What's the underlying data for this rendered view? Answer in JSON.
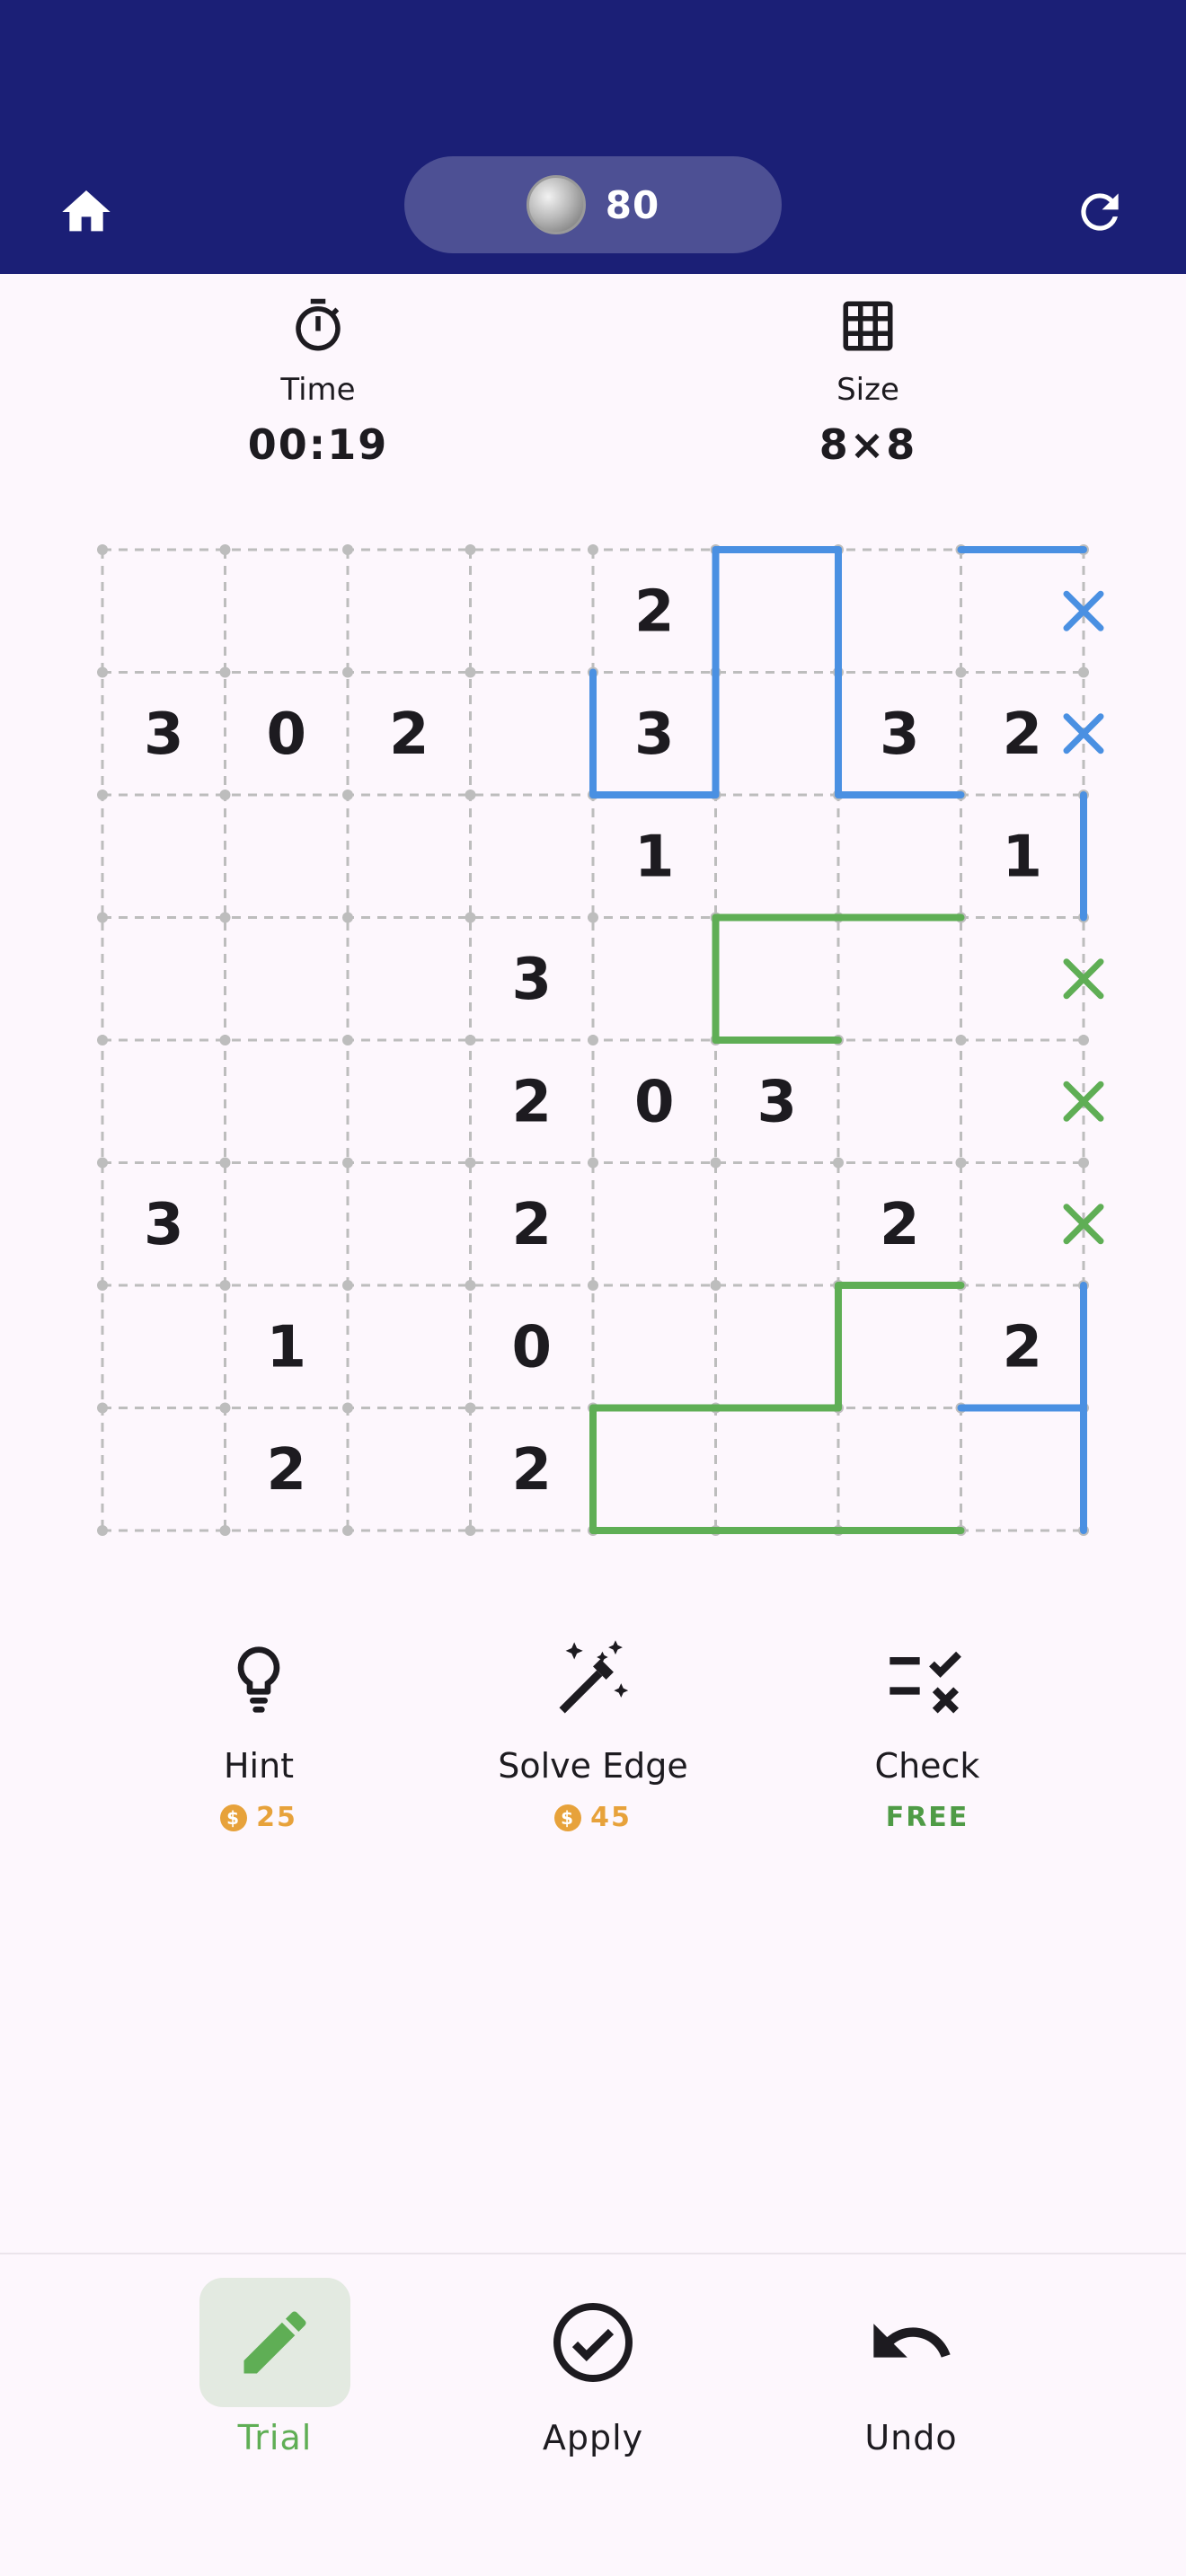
{
  "topbar": {
    "coins": "80",
    "home_icon": "home-icon",
    "refresh_icon": "refresh-icon"
  },
  "stats": {
    "time_label": "Time",
    "time_value": "00:19",
    "size_label": "Size",
    "size_value": "8×8"
  },
  "board": {
    "rows": 8,
    "cols": 8,
    "clues": [
      [
        "",
        "",
        "",
        "",
        "2",
        "",
        "",
        ""
      ],
      [
        "3",
        "0",
        "2",
        "",
        "3",
        "",
        "3",
        "2"
      ],
      [
        "",
        "",
        "",
        "",
        "1",
        "",
        "",
        "1"
      ],
      [
        "",
        "",
        "",
        "3",
        "",
        "",
        "",
        ""
      ],
      [
        "",
        "",
        "",
        "2",
        "0",
        "3",
        "",
        ""
      ],
      [
        "3",
        "",
        "",
        "2",
        "",
        "",
        "2",
        ""
      ],
      [
        "",
        "1",
        "",
        "0",
        "",
        "",
        "",
        "2"
      ],
      [
        "",
        "2",
        "",
        "2",
        "",
        "",
        "",
        ""
      ]
    ],
    "colors": {
      "blue": "#4a90e2",
      "green": "#5fae55",
      "grid": "#bdbdbd"
    },
    "blue_edges": [
      [
        4,
        1,
        4,
        2
      ],
      [
        5,
        0,
        5,
        2
      ],
      [
        4,
        2,
        5,
        2
      ],
      [
        5,
        0,
        6,
        0
      ],
      [
        6,
        0,
        6,
        2
      ],
      [
        6,
        2,
        7,
        2
      ],
      [
        7,
        0,
        8,
        0
      ],
      [
        8,
        2,
        8,
        3
      ],
      [
        8,
        6,
        8,
        8
      ],
      [
        7,
        7,
        8,
        7
      ]
    ],
    "green_edges": [
      [
        5,
        3,
        7,
        3
      ],
      [
        5,
        3,
        5,
        4
      ],
      [
        5,
        4,
        6,
        4
      ],
      [
        6,
        6,
        7,
        6
      ],
      [
        6,
        6,
        6,
        7
      ],
      [
        4,
        7,
        6,
        7
      ],
      [
        4,
        7,
        4,
        8
      ],
      [
        4,
        8,
        7,
        8
      ]
    ],
    "marks": [
      {
        "row": 0,
        "color": "blue"
      },
      {
        "row": 1,
        "color": "blue"
      },
      {
        "row": 3,
        "color": "green"
      },
      {
        "row": 4,
        "color": "green"
      },
      {
        "row": 5,
        "color": "green"
      }
    ]
  },
  "tools": {
    "hint_label": "Hint",
    "hint_cost": "25",
    "solve_label": "Solve Edge",
    "solve_cost": "45",
    "check_label": "Check",
    "check_cost": "FREE"
  },
  "nav": {
    "trial_label": "Trial",
    "apply_label": "Apply",
    "undo_label": "Undo"
  }
}
